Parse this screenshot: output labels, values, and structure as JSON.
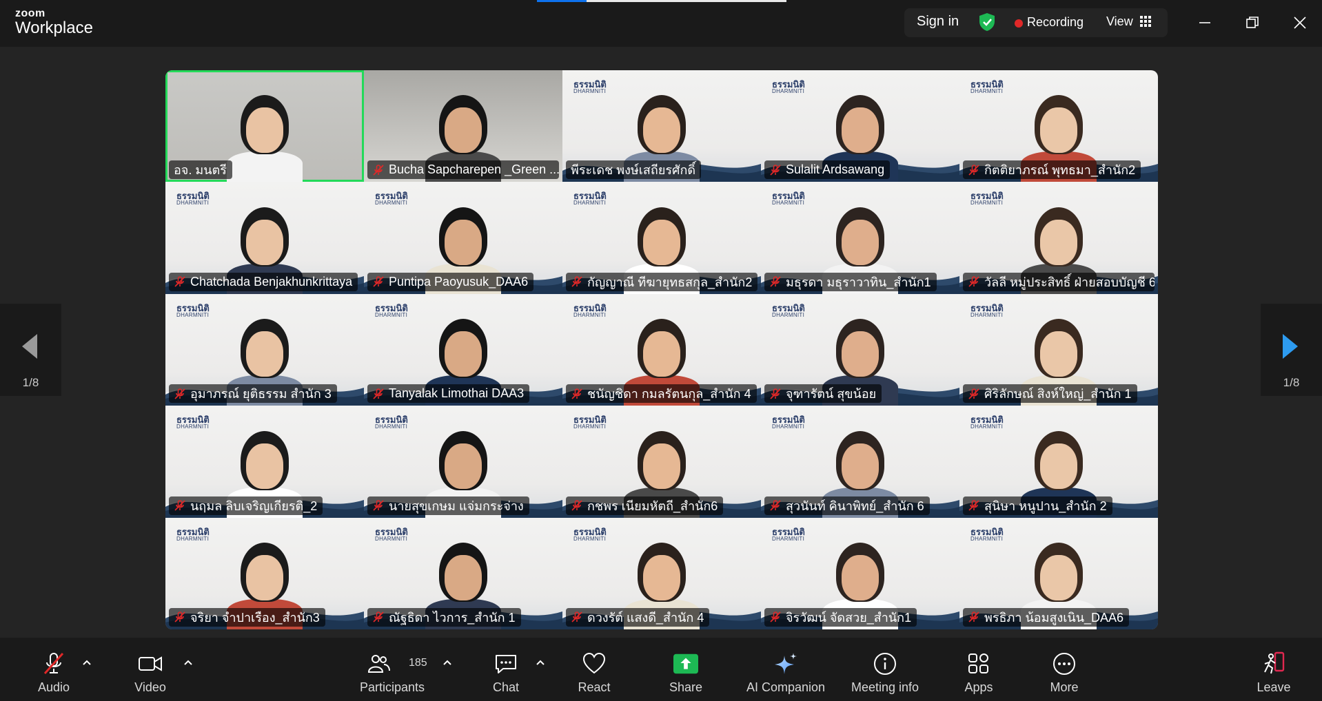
{
  "app": {
    "logo_line1": "zoom",
    "logo_line2": "Workplace"
  },
  "topbar": {
    "sign_in": "Sign in",
    "recording": "Recording",
    "view": "View",
    "share_progress_fraction": 0.2
  },
  "pager": {
    "left": "1/8",
    "right": "1/8"
  },
  "brand": {
    "thai": "ธรรมนิติ",
    "eng": "DHARMNITI"
  },
  "participants": [
    {
      "name": "อจ. มนตรี",
      "muted": false,
      "active": true,
      "cam": true
    },
    {
      "name": "Bucha Sapcharepen _Green ...",
      "muted": true,
      "cam": true
    },
    {
      "name": "พีระเดช พงษ์เสถียรศักดิ์",
      "muted": false,
      "brand": true
    },
    {
      "name": "Sulalit Ardsawang",
      "muted": true,
      "brand": true
    },
    {
      "name": "กิตติยาภรณ์ พุทธมา_สำนัก2",
      "muted": true,
      "brand": true
    },
    {
      "name": "Chatchada Benjakhunkrittaya",
      "muted": true,
      "brand": true
    },
    {
      "name": "Puntipa Paoyusuk_DAA6",
      "muted": true,
      "brand": true
    },
    {
      "name": "กัญญาณี ทีฆายุทธสกุล_สำนัก2",
      "muted": true,
      "brand": true
    },
    {
      "name": "มธุรดา มธุราวาทิน_สำนัก1",
      "muted": true,
      "brand": true
    },
    {
      "name": "วัลลี หมู่ประสิทธิ์ ฝ่ายสอบบัญชี 6",
      "muted": true,
      "brand": true
    },
    {
      "name": "อุมาภรณ์ ยุติธรรม สำนัก 3",
      "muted": true,
      "brand": true
    },
    {
      "name": "Tanyalak Limothai DAA3",
      "muted": true,
      "brand": true
    },
    {
      "name": "ชนัญชิดา กมลรัตนกุล_สำนัก 4",
      "muted": true,
      "brand": true
    },
    {
      "name": "จุฑารัตน์ สุขน้อย",
      "muted": true,
      "brand": true
    },
    {
      "name": "ศิริลักษณ์ สิงห์ใหญ่_สำนัก 1",
      "muted": true,
      "brand": true
    },
    {
      "name": "นฤมล ลิบเจริญเกียรติ_2",
      "muted": true,
      "brand": true
    },
    {
      "name": "นายสุขเกษม แจ่มกระจ่าง",
      "muted": true,
      "brand": true
    },
    {
      "name": "กชพร เนียมหัตถี_สำนัก6",
      "muted": true,
      "brand": true
    },
    {
      "name": "สุวนันท์ คินาพิทย์_สำนัก 6",
      "muted": true,
      "brand": true
    },
    {
      "name": "สุนิษา หนูปาน_สำนัก 2",
      "muted": true,
      "brand": true
    },
    {
      "name": "จริยา จำปาเรือง_สำนัก3",
      "muted": true,
      "brand": true
    },
    {
      "name": "ณัฐธิดา ไวการ_สำนัก 1",
      "muted": true,
      "brand": true
    },
    {
      "name": "ดวงรัต์ แสงดี_สำนัก 4",
      "muted": true,
      "brand": true
    },
    {
      "name": "จิรวัฒน์ จัดสวย_สำนัก1",
      "muted": true,
      "brand": true
    },
    {
      "name": "พรธิภา น้อมสูงเนิน_DAA6",
      "muted": true,
      "brand": true
    }
  ],
  "toolbar": {
    "audio": "Audio",
    "video": "Video",
    "participants": "Participants",
    "participants_count": "185",
    "chat": "Chat",
    "react": "React",
    "share": "Share",
    "ai_companion": "AI Companion",
    "meeting_info": "Meeting info",
    "apps": "Apps",
    "more": "More",
    "leave": "Leave"
  },
  "colors": {
    "active_speaker": "#23d959",
    "recording": "#e02828",
    "share": "#1db954",
    "nav_arrow_active": "#2d9bf0"
  }
}
